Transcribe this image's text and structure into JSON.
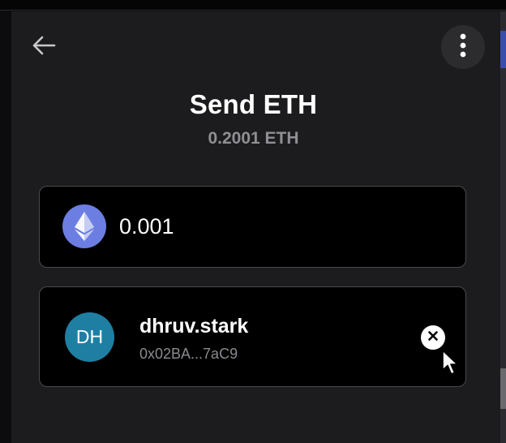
{
  "header": {
    "title": "Send ETH",
    "balance": "0.2001 ETH"
  },
  "icons": {
    "back": "arrow-left-icon",
    "menu": "more-vertical-icon",
    "token": "ethereum-icon",
    "clear": "close-circle-icon",
    "pointer": "mouse-pointer-icon"
  },
  "amount": {
    "value": "0.001"
  },
  "recipient": {
    "initials": "DH",
    "name": "dhruv.stark",
    "address": "0x02BA...7aC9"
  },
  "colors": {
    "background": "#1c1c1e",
    "card": "#000000",
    "card_border": "#4a4a4e",
    "eth_token": "#6c7ee1",
    "avatar": "#1e7fa3",
    "muted_text": "#8f8f94"
  }
}
